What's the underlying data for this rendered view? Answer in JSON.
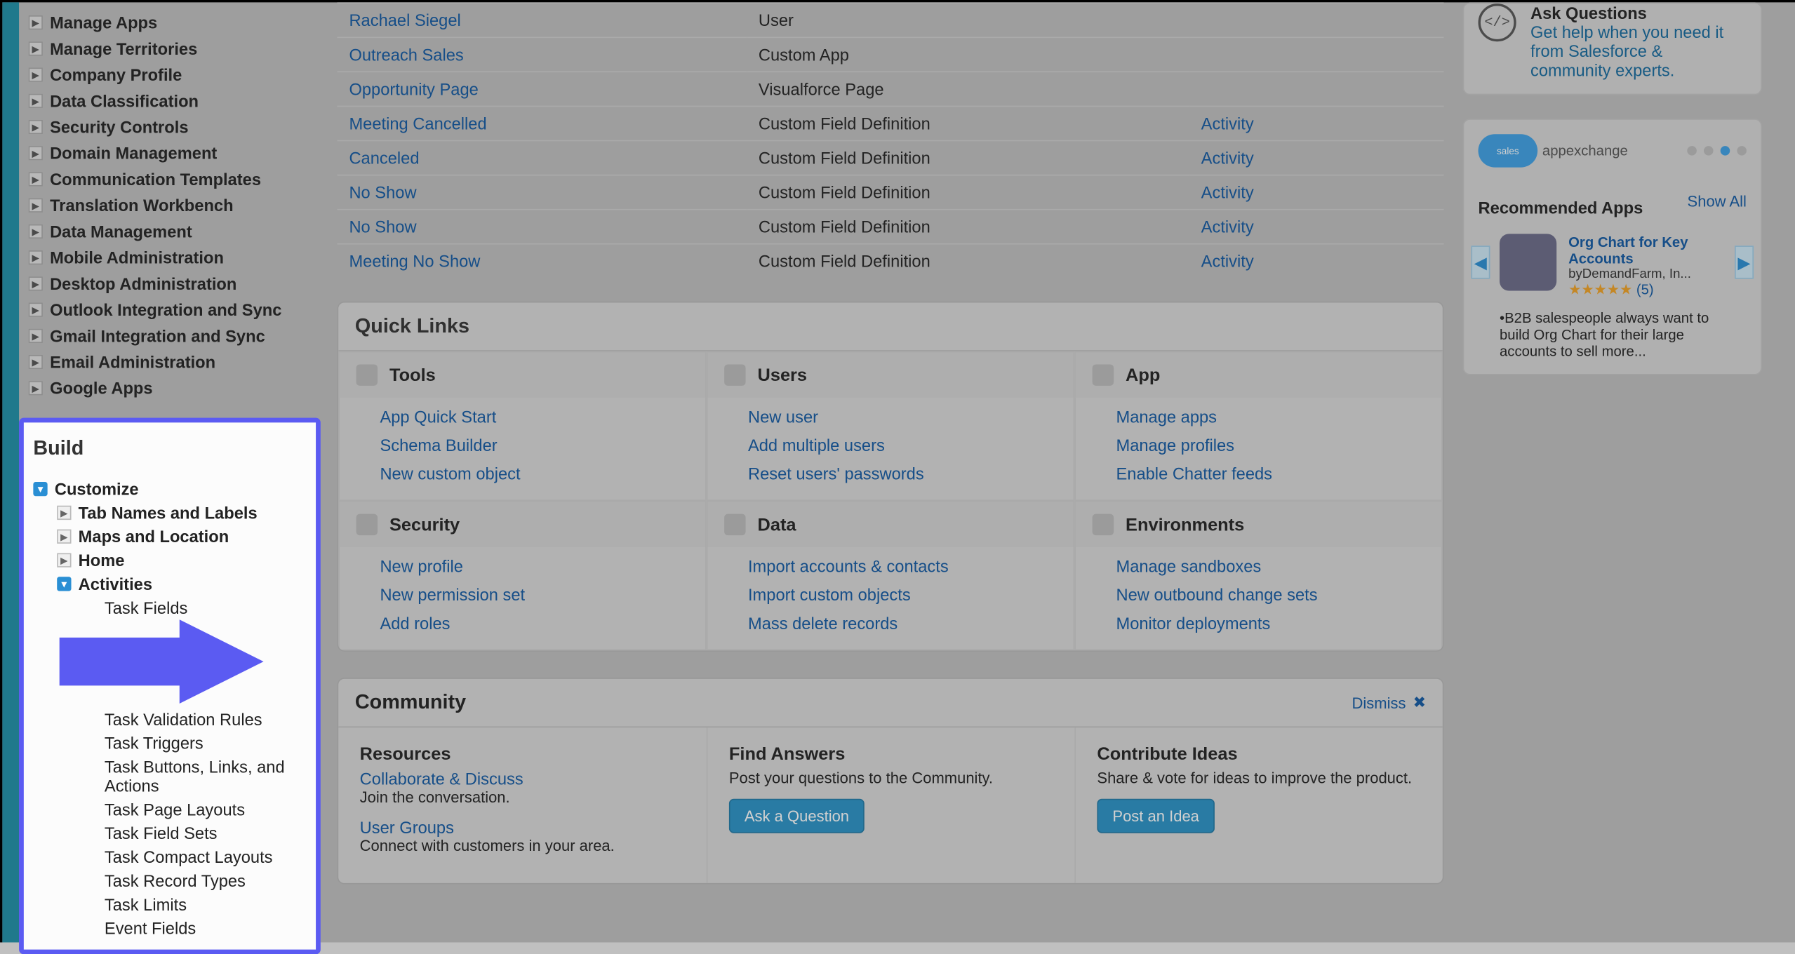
{
  "sidebar": {
    "items": [
      "Manage Apps",
      "Manage Territories",
      "Company Profile",
      "Data Classification",
      "Security Controls",
      "Domain Management",
      "Communication Templates",
      "Translation Workbench",
      "Data Management",
      "Mobile Administration",
      "Desktop Administration",
      "Outlook Integration and Sync",
      "Gmail Integration and Sync",
      "Email Administration",
      "Google Apps"
    ],
    "build": {
      "title": "Build",
      "customize": "Customize",
      "children": [
        "Tab Names and Labels",
        "Maps and Location",
        "Home"
      ],
      "activities": "Activities",
      "task_items": [
        "Task Fields",
        "Task Validation Rules",
        "Task Triggers",
        "Task Buttons, Links, and Actions",
        "Task Page Layouts",
        "Task Field Sets",
        "Task Compact Layouts",
        "Task Record Types",
        "Task Limits",
        "Event Fields"
      ]
    }
  },
  "table": {
    "rows": [
      {
        "name": "Rachael Siegel",
        "type": "User",
        "obj": ""
      },
      {
        "name": "Outreach Sales",
        "type": "Custom App",
        "obj": ""
      },
      {
        "name": "Opportunity Page",
        "type": "Visualforce Page",
        "obj": ""
      },
      {
        "name": "Meeting Cancelled",
        "type": "Custom Field Definition",
        "obj": "Activity"
      },
      {
        "name": "Canceled",
        "type": "Custom Field Definition",
        "obj": "Activity"
      },
      {
        "name": "No Show",
        "type": "Custom Field Definition",
        "obj": "Activity"
      },
      {
        "name": "No Show",
        "type": "Custom Field Definition",
        "obj": "Activity"
      },
      {
        "name": "Meeting No Show",
        "type": "Custom Field Definition",
        "obj": "Activity"
      }
    ]
  },
  "quicklinks": {
    "title": "Quick Links",
    "sections": [
      {
        "title": "Tools",
        "links": [
          "App Quick Start",
          "Schema Builder",
          "New custom object"
        ]
      },
      {
        "title": "Users",
        "links": [
          "New user",
          "Add multiple users",
          "Reset users' passwords"
        ]
      },
      {
        "title": "App",
        "links": [
          "Manage apps",
          "Manage profiles",
          "Enable Chatter feeds"
        ]
      },
      {
        "title": "Security",
        "links": [
          "New profile",
          "New permission set",
          "Add roles"
        ]
      },
      {
        "title": "Data",
        "links": [
          "Import accounts & contacts",
          "Import custom objects",
          "Mass delete records"
        ]
      },
      {
        "title": "Environments",
        "links": [
          "Manage sandboxes",
          "New outbound change sets",
          "Monitor deployments"
        ]
      }
    ]
  },
  "community": {
    "title": "Community",
    "dismiss": "Dismiss",
    "resources": {
      "title": "Resources",
      "collab": "Collaborate & Discuss",
      "collab_sub": "Join the conversation.",
      "groups": "User Groups",
      "groups_sub": "Connect with customers in your area."
    },
    "find": {
      "title": "Find Answers",
      "sub": "Post your questions to the Community.",
      "btn": "Ask a Question"
    },
    "ideas": {
      "title": "Contribute Ideas",
      "sub": "Share & vote for ideas to improve the product.",
      "btn": "Post an Idea"
    }
  },
  "ask": {
    "title": "Ask Questions",
    "desc": "Get help when you need it from Salesforce & community experts."
  },
  "appex": {
    "brand": "appexchange",
    "title": "Recommended Apps",
    "showall": "Show All",
    "app": {
      "name": "Org Chart for Key Accounts",
      "by": "byDemandFarm, In...",
      "rating": "★★★★★",
      "count": "(5)",
      "desc": "•B2B salespeople always want to build Org Chart for their large accounts to sell more..."
    }
  }
}
